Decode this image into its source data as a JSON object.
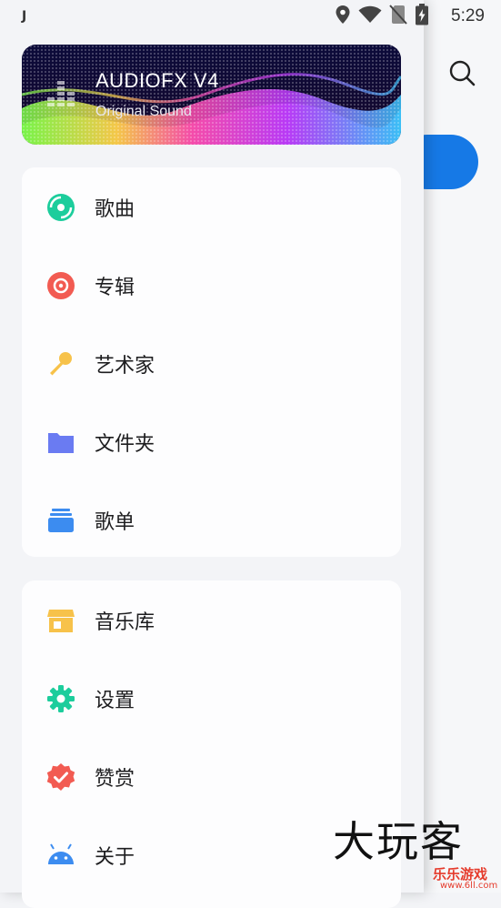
{
  "status_bar": {
    "left_indicator": "J",
    "time": "5:29",
    "icons": [
      "location-icon",
      "wifi-icon",
      "no-sim-icon",
      "battery-charging-icon"
    ]
  },
  "banner": {
    "title": "AUDIOFX V4",
    "subtitle": "Original Sound"
  },
  "menu_primary": [
    {
      "label": "歌曲",
      "icon": "song-disc-icon",
      "color": "#1ccd9c"
    },
    {
      "label": "专辑",
      "icon": "album-disc-icon",
      "color": "#f25b52"
    },
    {
      "label": "艺术家",
      "icon": "microphone-icon",
      "color": "#f7c24a"
    },
    {
      "label": "文件夹",
      "icon": "folder-icon",
      "color": "#6a7bf2"
    },
    {
      "label": "歌单",
      "icon": "playlist-stack-icon",
      "color": "#3c8cf0"
    }
  ],
  "menu_secondary": [
    {
      "label": "音乐库",
      "icon": "store-icon",
      "color": "#f7c24a"
    },
    {
      "label": "设置",
      "icon": "gear-icon",
      "color": "#1ccd9c"
    },
    {
      "label": "赞赏",
      "icon": "verified-badge-icon",
      "color": "#f25b52"
    },
    {
      "label": "关于",
      "icon": "android-icon",
      "color": "#3c8cf0"
    }
  ],
  "background_app": {
    "search_icon": "search-icon",
    "accent": "#1679e6"
  },
  "watermark": {
    "main": "大玩客",
    "sub": "乐乐游戏",
    "url": "www.6ll.com"
  }
}
